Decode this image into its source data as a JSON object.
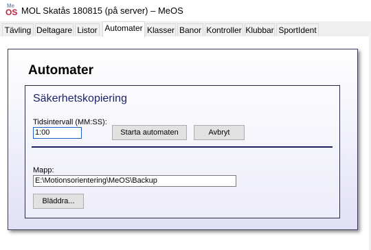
{
  "window": {
    "title": "MOL Skatås 180815 (på server) – MeOS",
    "icon": {
      "top": "Me",
      "bottom": "OS",
      "name": "meos-app-icon"
    }
  },
  "tabs": [
    {
      "label": "Tävling",
      "active": false
    },
    {
      "label": "Deltagare",
      "active": false
    },
    {
      "label": "Listor",
      "active": false
    },
    {
      "label": "Automater",
      "active": true
    },
    {
      "label": "Klasser",
      "active": false
    },
    {
      "label": "Banor",
      "active": false
    },
    {
      "label": "Kontroller",
      "active": false
    },
    {
      "label": "Klubbar",
      "active": false
    },
    {
      "label": "SportIdent",
      "active": false
    }
  ],
  "page": {
    "heading": "Automater"
  },
  "backup": {
    "title": "Säkerhetskopiering",
    "interval_label": "Tidsintervall (MM:SS):",
    "interval_value": "1:00",
    "start_button": "Starta automaten",
    "cancel_button": "Avbryt",
    "folder_label": "Mapp:",
    "folder_value": "E:\\Motionsorientering\\MeOS\\Backup",
    "browse_button": "Bläddra..."
  },
  "colors": {
    "heading_blue": "#1a1f6a",
    "panel_gradient_bottom": "#e2e0f6",
    "divider": "#1a1f5a"
  }
}
